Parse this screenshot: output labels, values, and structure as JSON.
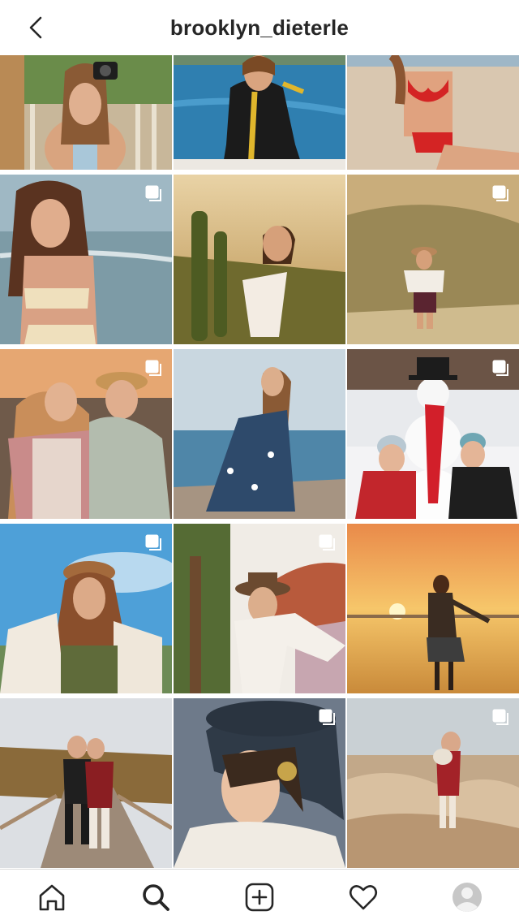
{
  "header": {
    "username": "brooklyn_dieterle",
    "back_icon": "chevron-left-icon"
  },
  "grid": {
    "tiles": [
      {
        "id": 1,
        "scene": "girl-with-camera-by-fence",
        "multiple": false
      },
      {
        "id": 2,
        "scene": "girl-in-wetsuit-by-lake",
        "multiple": false
      },
      {
        "id": 3,
        "scene": "girl-in-red-bikini-on-beach",
        "multiple": false
      },
      {
        "id": 4,
        "scene": "girl-at-ocean-shore",
        "multiple": true
      },
      {
        "id": 5,
        "scene": "girl-with-cactus-at-sunset",
        "multiple": false
      },
      {
        "id": 6,
        "scene": "girl-in-hat-in-desert",
        "multiple": true
      },
      {
        "id": 7,
        "scene": "two-girls-at-sunset-coast",
        "multiple": true
      },
      {
        "id": 8,
        "scene": "girl-in-dress-on-rocks",
        "multiple": false
      },
      {
        "id": 9,
        "scene": "two-girls-with-snowman",
        "multiple": true
      },
      {
        "id": 10,
        "scene": "girl-in-hat-blue-sky",
        "multiple": true
      },
      {
        "id": 11,
        "scene": "girl-in-hat-by-tree",
        "multiple": true
      },
      {
        "id": 12,
        "scene": "girl-on-beach-at-sunset",
        "multiple": false
      },
      {
        "id": 13,
        "scene": "two-girls-on-boardwalk",
        "multiple": false
      },
      {
        "id": 14,
        "scene": "pirate-costume-portrait",
        "multiple": true
      },
      {
        "id": 15,
        "scene": "girl-with-dog-on-rocks",
        "multiple": true
      }
    ]
  },
  "tabbar": {
    "items": [
      {
        "name": "home",
        "icon": "home-icon"
      },
      {
        "name": "search",
        "icon": "search-icon",
        "active": true
      },
      {
        "name": "new-post",
        "icon": "plus-square-icon"
      },
      {
        "name": "activity",
        "icon": "heart-icon"
      },
      {
        "name": "profile",
        "icon": "avatar-icon"
      }
    ]
  }
}
